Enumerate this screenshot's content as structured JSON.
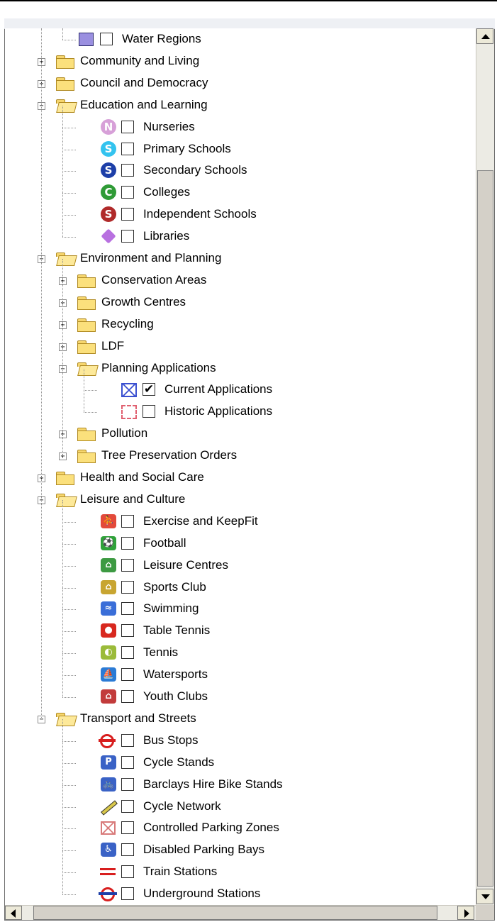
{
  "tree": {
    "water_regions": "Water Regions",
    "community": "Community and Living",
    "council": "Council and Democracy",
    "education": {
      "label": "Education and Learning",
      "items": [
        "Nurseries",
        "Primary Schools",
        "Secondary Schools",
        "Colleges",
        "Independent Schools",
        "Libraries"
      ]
    },
    "environment": {
      "label": "Environment and Planning",
      "conservation": "Conservation Areas",
      "growth": "Growth Centres",
      "recycling": "Recycling",
      "ldf": "LDF",
      "planning": {
        "label": "Planning Applications",
        "current": "Current Applications",
        "current_checked": true,
        "historic": "Historic Applications"
      },
      "pollution": "Pollution",
      "tpo": "Tree Preservation Orders"
    },
    "health": "Health and Social Care",
    "leisure": {
      "label": "Leisure and Culture",
      "items": [
        "Exercise and KeepFit",
        "Football",
        "Leisure Centres",
        "Sports Club",
        "Swimming",
        "Table Tennis",
        "Tennis",
        "Watersports",
        "Youth Clubs"
      ]
    },
    "transport": {
      "label": "Transport and Streets",
      "items": [
        "Bus Stops",
        "Cycle Stands",
        "Barclays Hire Bike Stands",
        "Cycle Network",
        "Controlled Parking Zones",
        "Disabled Parking Bays",
        "Train Stations",
        "Underground Stations"
      ]
    }
  },
  "icons": {
    "education": [
      "nursery-n-icon",
      "primary-school-s-icon",
      "secondary-school-s-icon",
      "college-c-icon",
      "independent-school-s-icon",
      "library-cube-icon"
    ],
    "education_letters": [
      "N",
      "S",
      "S",
      "C",
      "S",
      ""
    ],
    "education_colors": [
      "#d7a0d8",
      "#33c3ef",
      "#1d3fa8",
      "#2f9b36",
      "#b02a2a",
      "#b870e0"
    ],
    "leisure": [
      "exercise-icon",
      "football-icon",
      "leisure-centre-icon",
      "sports-club-icon",
      "swimming-icon",
      "table-tennis-icon",
      "tennis-icon",
      "watersports-icon",
      "youth-club-icon"
    ],
    "transport": [
      "bus-stop-roundel-icon",
      "cycle-stand-icon",
      "hire-bike-stand-icon",
      "cycle-network-icon",
      "controlled-parking-icon",
      "disabled-parking-icon",
      "train-station-icon",
      "underground-roundel-icon"
    ]
  },
  "colors": {
    "folder": "#fbe07c",
    "water_swatch": "#9a8fe0",
    "check": "#000000"
  }
}
